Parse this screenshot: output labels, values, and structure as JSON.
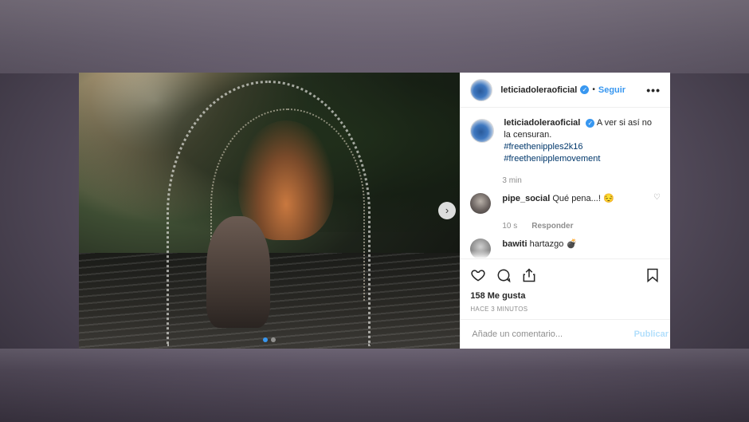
{
  "post": {
    "username": "leticiadoleraoficial",
    "verified_mark": "✓",
    "separator": "•",
    "follow_label": "Seguir",
    "more_label": "•••",
    "next_label": "›",
    "caption_text": "A ver si así no la censuran.",
    "hashtags": [
      "#freethenipples2k16",
      "#freethenipplemovement"
    ],
    "caption_time": "3 min",
    "comments": [
      {
        "username": "pipe_social",
        "text": "Qué pena...! 😔",
        "time": "10 s",
        "reply_label": "Responder"
      },
      {
        "username": "bawiti",
        "text": "hartazgo 💣"
      }
    ],
    "likes": "158 Me gusta",
    "posted_ago": "HACE 3 MINUTOS",
    "comment_placeholder": "Añade un comentario...",
    "publish_label": "Publicar"
  },
  "colors": {
    "accent": "#3897f0",
    "publish_disabled": "#b2dffc"
  },
  "icons": [
    "heart-icon",
    "comment-icon",
    "share-icon",
    "bookmark-icon",
    "verified-badge-icon",
    "more-options-icon",
    "chevron-right-icon"
  ]
}
